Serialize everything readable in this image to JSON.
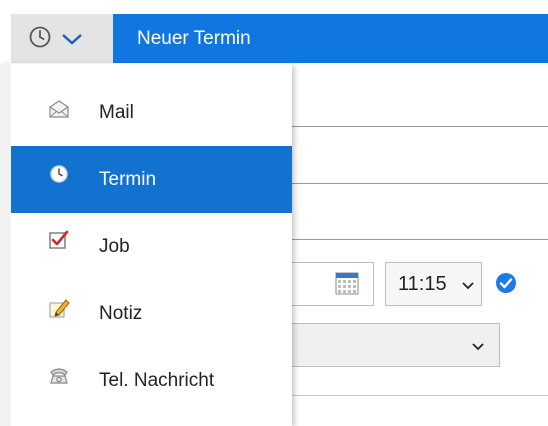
{
  "header": {
    "title": "Neuer Termin",
    "type_button_icon": "clock-icon",
    "accent_color": "#1177e0"
  },
  "menu": {
    "items": [
      {
        "label": "Mail",
        "icon": "mail-icon",
        "active": false
      },
      {
        "label": "Termin",
        "icon": "clock-icon",
        "active": true
      },
      {
        "label": "Job",
        "icon": "checkbox-icon",
        "active": false
      },
      {
        "label": "Notiz",
        "icon": "pencil-icon",
        "active": false
      },
      {
        "label": "Tel. Nachricht",
        "icon": "phone-icon",
        "active": false
      }
    ],
    "active_color": "#1272cf"
  },
  "form": {
    "time_value": "11:15"
  }
}
